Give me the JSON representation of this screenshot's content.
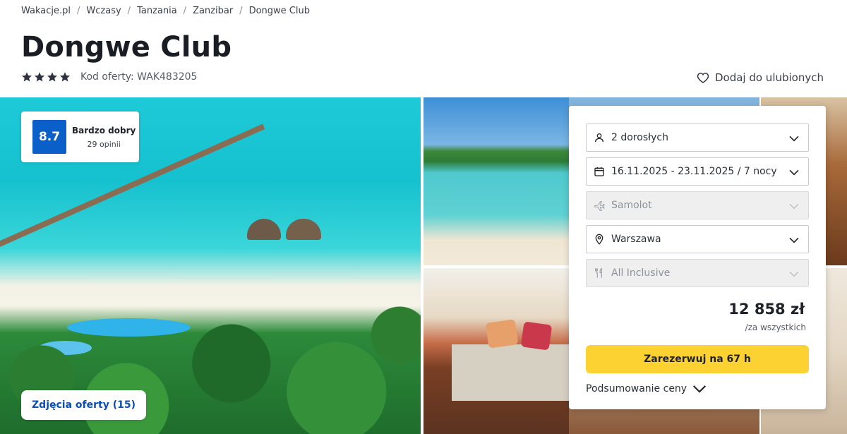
{
  "breadcrumb": [
    "Wakacje.pl",
    "Wczasy",
    "Tanzania",
    "Zanzibar",
    "Dongwe Club"
  ],
  "breadcrumb_separator": "/",
  "hotel": {
    "name": "Dongwe Club",
    "stars": 4,
    "offer_code_label": "Kod oferty: WAK483205"
  },
  "favorite_label": "Dodaj do ulubionych",
  "rating": {
    "score": "8.7",
    "label": "Bardzo dobry",
    "count": "29 opinii",
    "color": "#0b5fc9"
  },
  "photos_button": "Zdjęcia oferty (15)",
  "booking": {
    "travelers": "2 dorosłych",
    "dates": "16.11.2025 - 23.11.2025 / 7 nocy",
    "transport": "Samolot",
    "departure_city": "Warszawa",
    "board": "All Inclusive",
    "price": "12 858 zł",
    "price_note": "/za wszystkich",
    "book_button": "Zarezerwuj na 67 h",
    "summary_link": "Podsumowanie ceny",
    "accent_color": "#fcd232"
  },
  "icons": {
    "travelers": "person-icon",
    "dates": "calendar-icon",
    "transport": "plane-icon",
    "departure_city": "location-pin-icon",
    "board": "cutlery-icon",
    "favorite": "heart-icon",
    "dropdown": "chevron-down-icon"
  }
}
